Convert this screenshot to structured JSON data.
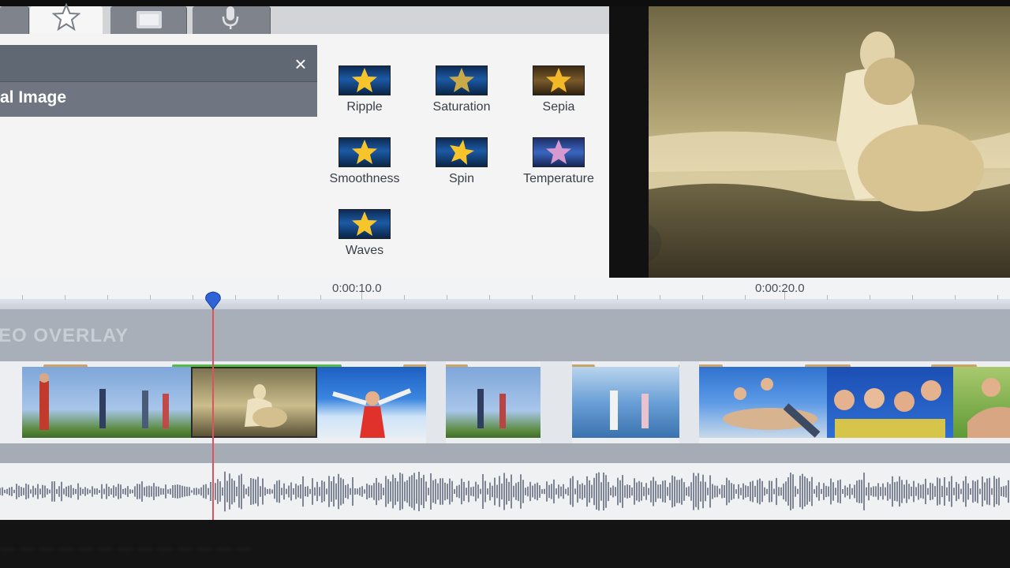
{
  "toolbar": {
    "tabs": [
      {
        "icon": "star-icon",
        "active": true
      },
      {
        "icon": "film-icon",
        "active": false
      },
      {
        "icon": "microphone-icon",
        "active": false
      }
    ]
  },
  "effects_panel": {
    "header_title": "al Image",
    "close_label": "×",
    "effects": [
      {
        "label": "Ripple",
        "thumb": "blue"
      },
      {
        "label": "Saturation",
        "thumb": "blue"
      },
      {
        "label": "Sepia",
        "thumb": "warm"
      },
      {
        "label": "Smoothness",
        "thumb": "blue"
      },
      {
        "label": "Spin",
        "thumb": "blue"
      },
      {
        "label": "Temperature",
        "thumb": "cool"
      },
      {
        "label": "Waves",
        "thumb": "blue"
      }
    ]
  },
  "timeline": {
    "time_labels": [
      "0:00:10.0",
      "0:00:20.0"
    ],
    "overlay_track_label": "EO OVERLAY",
    "footer_text": "— — — — — — — — — — — — —"
  },
  "colors": {
    "accent_playhead": "#e0525a",
    "marker_blue": "#2f63d8",
    "clip_bar": "#c9a46a",
    "selected_bar": "#58b848"
  }
}
